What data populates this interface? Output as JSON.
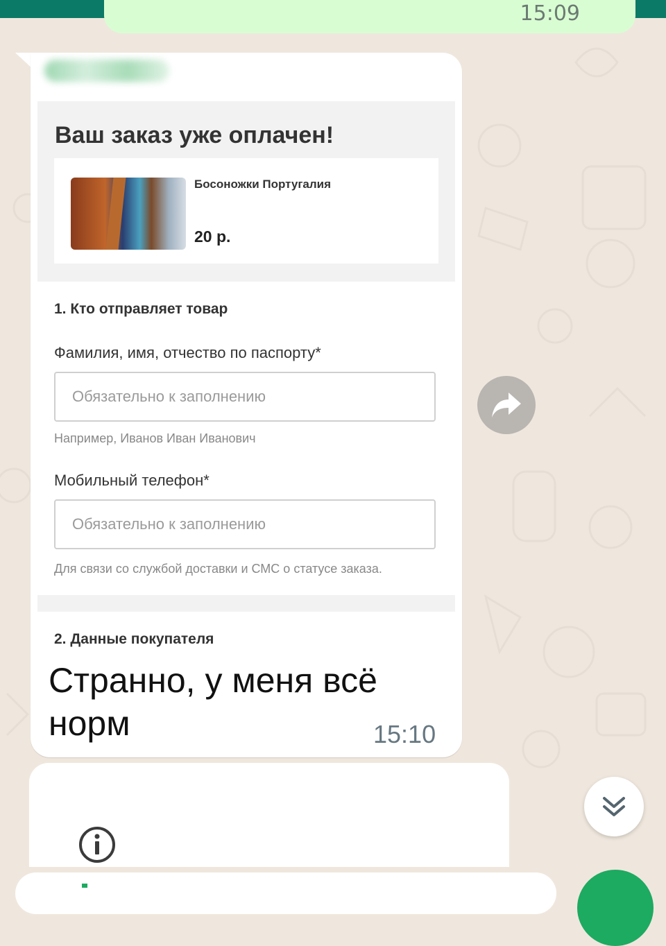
{
  "chat": {
    "previous_time": "15:09",
    "message": {
      "text_line1": "Странно, у меня всё",
      "text_line2": "норм",
      "time": "15:10"
    }
  },
  "screenshot": {
    "order_title": "Ваш заказ уже оплачен!",
    "product": {
      "name": "Босоножки Португалия",
      "price": "20 р."
    },
    "section1_title": "1. Кто отправляет товар",
    "name_field": {
      "label": "Фамилия, имя, отчество по паспорту*",
      "placeholder": "Обязательно к заполнению",
      "value": "",
      "hint": "Например, Иванов Иван Иванович"
    },
    "phone_field": {
      "label": "Мобильный телефон*",
      "placeholder": "Обязательно к заполнению",
      "value": "",
      "hint": "Для связи со службой доставки и СМС о статусе заказа."
    },
    "section2_title": "2. Данные покупателя"
  },
  "icons": {
    "forward": "forward-icon",
    "scroll_down": "double-chevron-down-icon",
    "info": "info-icon"
  },
  "colors": {
    "header": "#0b7a66",
    "outgoing_bubble": "#d9fdd3",
    "incoming_bubble": "#ffffff",
    "chat_background": "#efe7dd",
    "send_button": "#1daa61"
  }
}
